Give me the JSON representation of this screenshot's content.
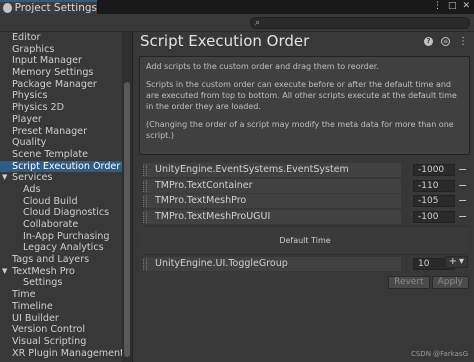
{
  "window": {
    "tab_title": "Project Settings"
  },
  "sidebar": {
    "items": [
      {
        "label": "Editor",
        "indent": 0
      },
      {
        "label": "Graphics",
        "indent": 0
      },
      {
        "label": "Input Manager",
        "indent": 0
      },
      {
        "label": "Memory Settings",
        "indent": 0
      },
      {
        "label": "Package Manager",
        "indent": 0
      },
      {
        "label": "Physics",
        "indent": 0
      },
      {
        "label": "Physics 2D",
        "indent": 0
      },
      {
        "label": "Player",
        "indent": 0
      },
      {
        "label": "Preset Manager",
        "indent": 0
      },
      {
        "label": "Quality",
        "indent": 0
      },
      {
        "label": "Scene Template",
        "indent": 0
      },
      {
        "label": "Script Execution Order",
        "indent": 0,
        "selected": true
      },
      {
        "label": "Services",
        "indent": 0,
        "expand": true
      },
      {
        "label": "Ads",
        "indent": 1
      },
      {
        "label": "Cloud Build",
        "indent": 1
      },
      {
        "label": "Cloud Diagnostics",
        "indent": 1
      },
      {
        "label": "Collaborate",
        "indent": 1
      },
      {
        "label": "In-App Purchasing",
        "indent": 1
      },
      {
        "label": "Legacy Analytics",
        "indent": 1
      },
      {
        "label": "Tags and Layers",
        "indent": 0
      },
      {
        "label": "TextMesh Pro",
        "indent": 0,
        "expand": true
      },
      {
        "label": "Settings",
        "indent": 1
      },
      {
        "label": "Time",
        "indent": 0
      },
      {
        "label": "Timeline",
        "indent": 0
      },
      {
        "label": "UI Builder",
        "indent": 0
      },
      {
        "label": "Version Control",
        "indent": 0
      },
      {
        "label": "Visual Scripting",
        "indent": 0
      },
      {
        "label": "XR Plugin Management",
        "indent": 0
      }
    ]
  },
  "main": {
    "title": "Script Execution Order",
    "info": [
      "Add scripts to the custom order and drag them to reorder.",
      "Scripts in the custom order can execute before or after the default time and are executed from top to bottom. All other scripts execute at the default time in the order they are loaded.",
      "(Changing the order of a script may modify the meta data for more than one script.)"
    ],
    "scripts_before": [
      {
        "name": "UnityEngine.EventSystems.EventSystem",
        "order": "-1000"
      },
      {
        "name": "TMPro.TextContainer",
        "order": "-110"
      },
      {
        "name": "TMPro.TextMeshPro",
        "order": "-105"
      },
      {
        "name": "TMPro.TextMeshProUGUI",
        "order": "-100"
      }
    ],
    "default_time_label": "Default Time",
    "scripts_after": [
      {
        "name": "UnityEngine.UI.ToggleGroup",
        "order": "10"
      }
    ],
    "remove_label": "−",
    "add_label": "+",
    "add_dropdown": "▾",
    "revert_label": "Revert",
    "apply_label": "Apply"
  },
  "watermark": "CSDN @FarkasG",
  "colors": {
    "selected": "#2c5d87",
    "background": "#383838"
  }
}
